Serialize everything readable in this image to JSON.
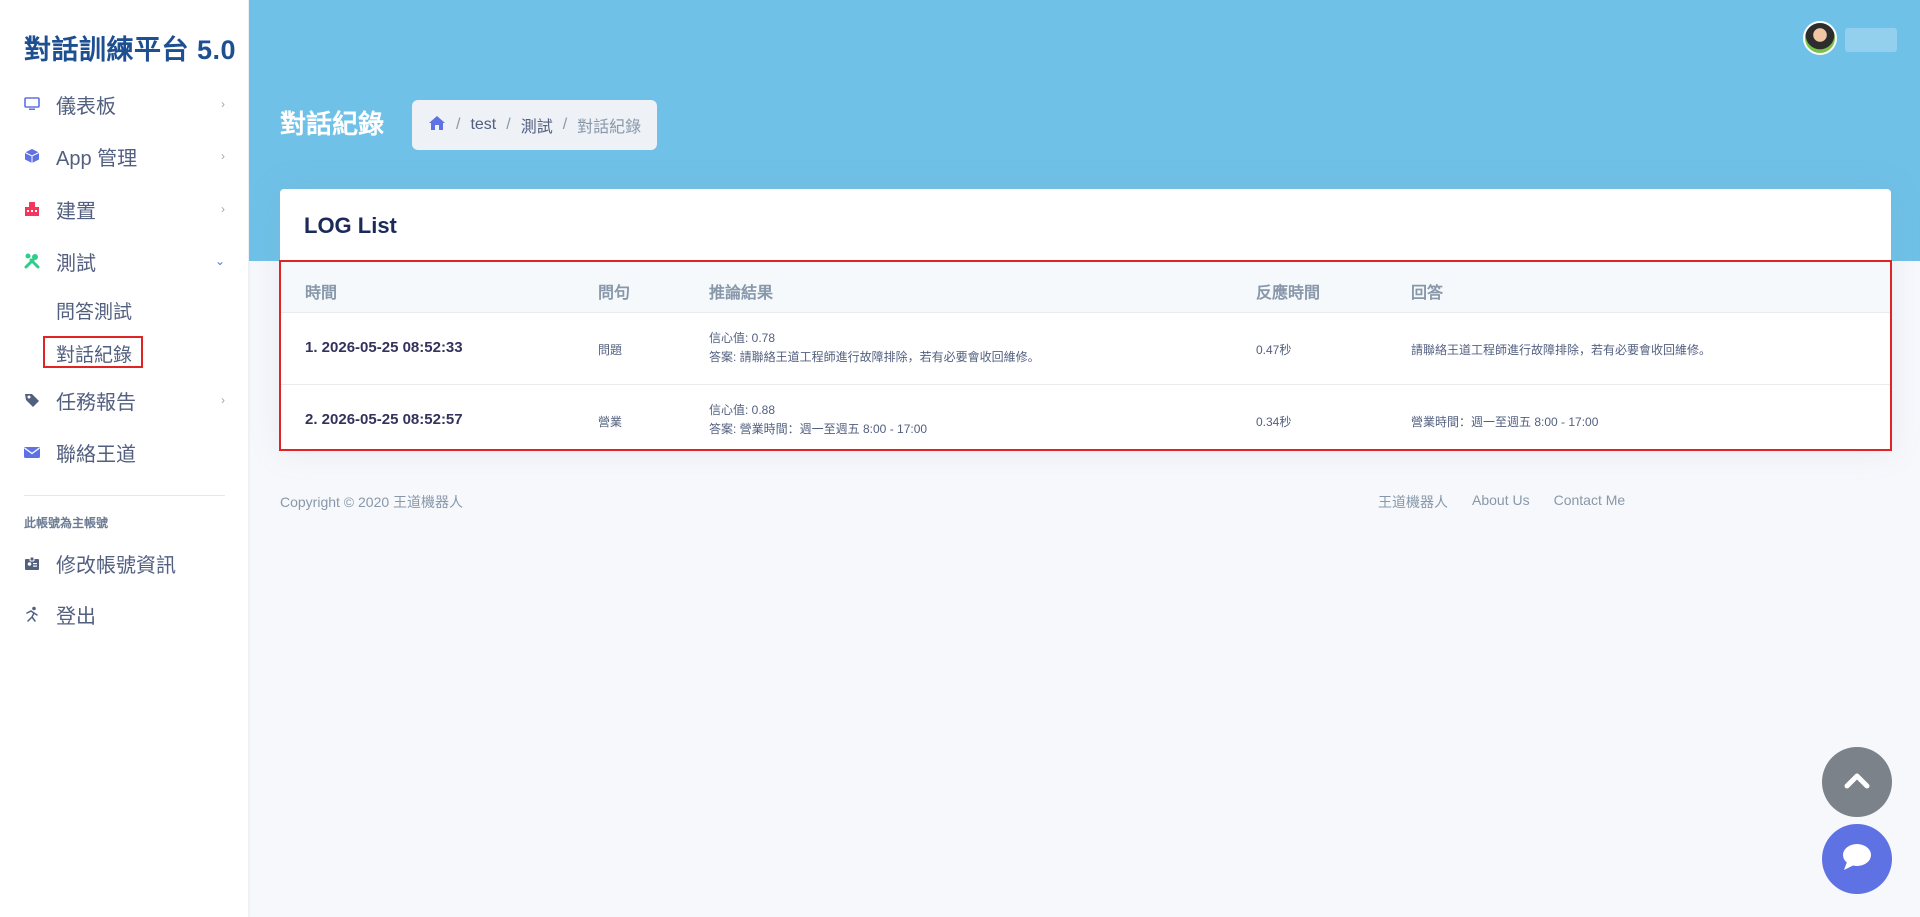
{
  "brand": "對話訓練平台 5.0",
  "sidebar": {
    "items": [
      {
        "label": "儀表板",
        "icon": "monitor-icon"
      },
      {
        "label": "App 管理",
        "icon": "cube-icon"
      },
      {
        "label": "建置",
        "icon": "building-icon"
      },
      {
        "label": "測試",
        "icon": "tools-icon"
      },
      {
        "label": "任務報告",
        "icon": "tag-icon"
      },
      {
        "label": "聯絡王道",
        "icon": "envelope-icon"
      }
    ],
    "sub_items": [
      {
        "label": "問答測試"
      },
      {
        "label": "對話紀錄"
      }
    ],
    "section_note": "此帳號為主帳號",
    "account_items": [
      {
        "label": "修改帳號資訊",
        "icon": "id-card-icon"
      },
      {
        "label": "登出",
        "icon": "running-icon"
      }
    ],
    "colors": {
      "brand": "#1d4f91",
      "active_outline": "#e02424"
    }
  },
  "header": {
    "page_title": "對話紀錄",
    "breadcrumb": [
      "test",
      "測試",
      "對話紀錄"
    ],
    "band_color": "#6fc1e8"
  },
  "card": {
    "title": "LOG List",
    "columns": [
      "時間",
      "問句",
      "推論結果",
      "反應時間",
      "回答"
    ],
    "rows": [
      {
        "time": "1. 2026-05-25 08:52:33",
        "question": "問題",
        "confidence": "信心值: 0.78",
        "answer_line": "答案: 請聯絡王道工程師進行故障排除，若有必要會收回維修。",
        "response_time": "0.47秒",
        "reply": "請聯絡王道工程師進行故障排除，若有必要會收回維修。"
      },
      {
        "time": "2. 2026-05-25 08:52:57",
        "question": "營業",
        "confidence": "信心值: 0.88",
        "answer_line": "答案: 營業時間：週一至週五 8:00 - 17:00",
        "response_time": "0.34秒",
        "reply": "營業時間：週一至週五 8:00 - 17:00"
      }
    ]
  },
  "footer": {
    "copyright": "Copyright © 2020 王道機器人",
    "links": [
      "王道機器人",
      "About Us",
      "Contact Me"
    ]
  },
  "fabs": {
    "top_color": "#7b8289",
    "chat_color": "#5e72e4"
  }
}
